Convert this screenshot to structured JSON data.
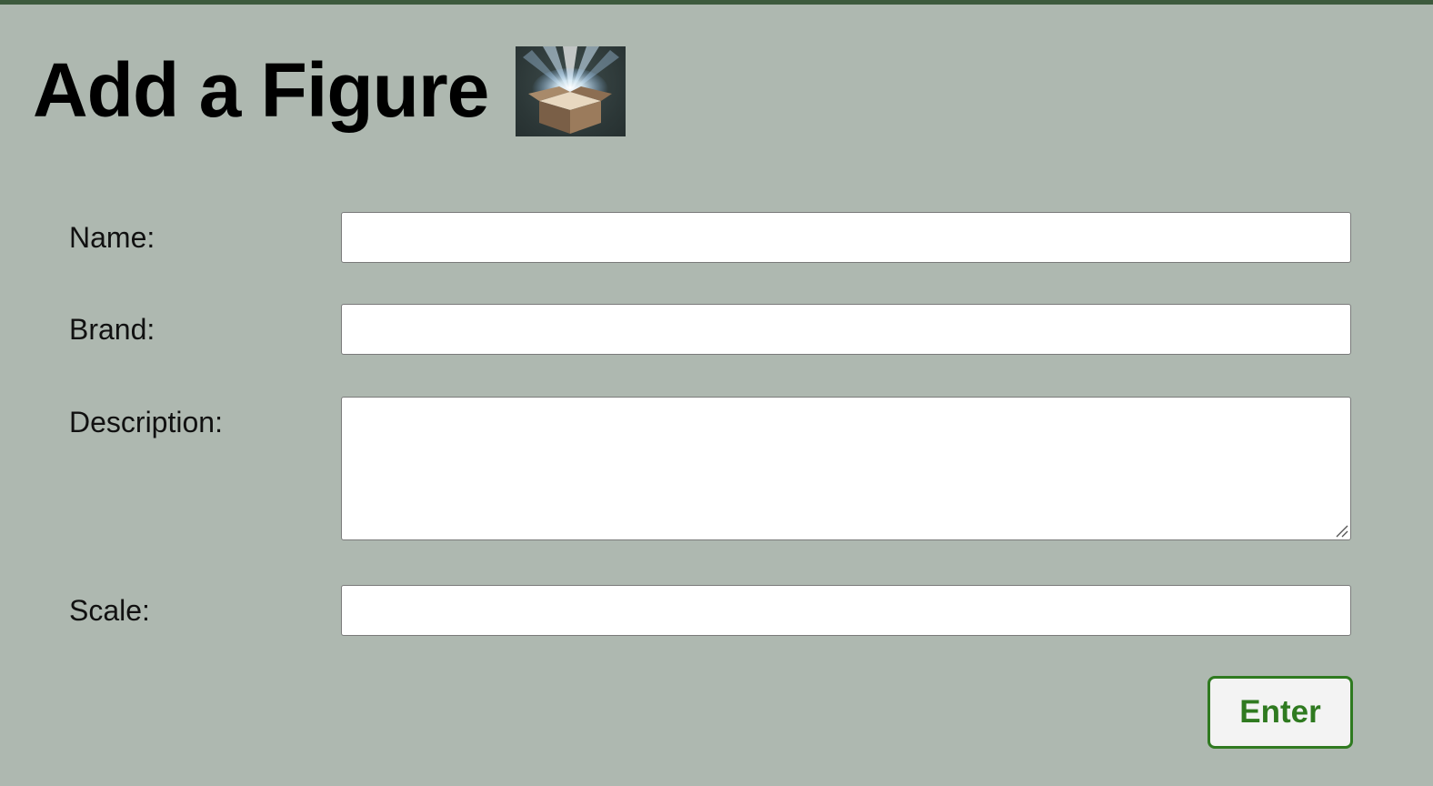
{
  "header": {
    "title": "Add a Figure",
    "image_icon": "open-box-with-light-icon"
  },
  "form": {
    "fields": [
      {
        "label": "Name:",
        "value": ""
      },
      {
        "label": "Brand:",
        "value": ""
      },
      {
        "label": "Description:",
        "value": ""
      },
      {
        "label": "Scale:",
        "value": ""
      }
    ],
    "submit_label": "Enter"
  },
  "colors": {
    "background": "#aeb8b0",
    "top_border": "#3d5a3d",
    "button_accent": "#2f7a20"
  }
}
